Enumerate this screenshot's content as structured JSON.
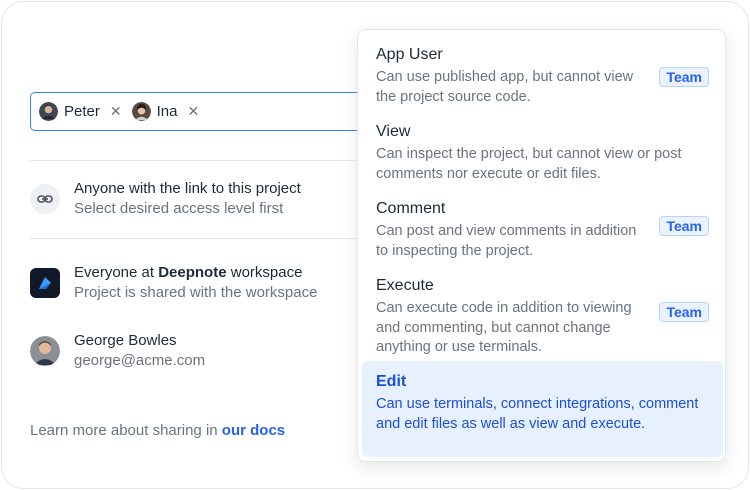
{
  "invitees": [
    {
      "name": "Peter",
      "remove": "✕"
    },
    {
      "name": "Ina",
      "remove": "✕"
    }
  ],
  "rows": {
    "link": {
      "title": "Anyone with the link to this project",
      "subtitle": "Select desired access level first",
      "icon": "link-icon"
    },
    "workspace": {
      "prefix": "Everyone at ",
      "workspace": "Deepnote",
      "suffix": " workspace",
      "subtitle": "Project is shared with the workspace",
      "icon": "deepnote-logo-icon"
    },
    "user": {
      "name": "George Bowles",
      "email": "george@acme.com"
    }
  },
  "footer": {
    "text": "Learn more about sharing in ",
    "link": "our docs"
  },
  "menu": {
    "options": [
      {
        "title": "App User",
        "desc": "Can use published app, but cannot view the project source code.",
        "badge": "Team"
      },
      {
        "title": "View",
        "desc": "Can inspect the project, but cannot view or post comments nor execute or edit files.",
        "badge": null
      },
      {
        "title": "Comment",
        "desc": "Can post and view comments in addition to inspecting the project.",
        "badge": "Team"
      },
      {
        "title": "Execute",
        "desc": "Can execute code in addition to viewing and commenting, but cannot change anything or use terminals.",
        "badge": "Team"
      },
      {
        "title": "Edit",
        "desc": "Can use terminals, connect integrations, comment and edit files as well as view and execute.",
        "badge": null,
        "selected": true
      }
    ]
  },
  "colors": {
    "accent": "#2563eb",
    "selected_bg": "#e6f0fe",
    "badge_border": "#b9d4fb"
  }
}
